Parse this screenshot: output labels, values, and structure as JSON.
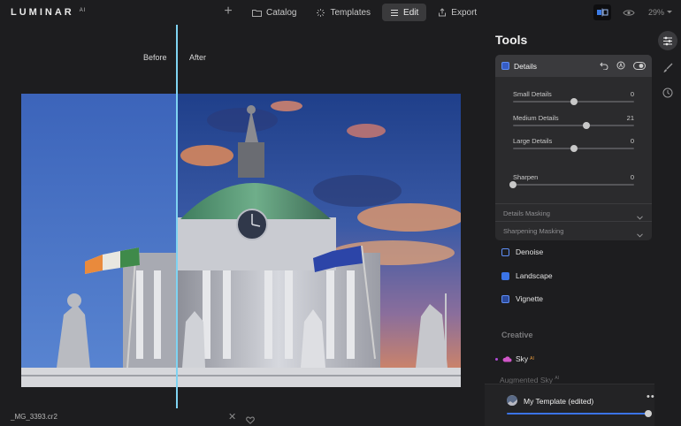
{
  "app": {
    "logo": "LUMINAR",
    "logo_suffix": "AI"
  },
  "nav": {
    "items": [
      {
        "label": "Catalog",
        "icon": "folder-icon"
      },
      {
        "label": "Templates",
        "icon": "templates-icon"
      },
      {
        "label": "Edit",
        "icon": "sliders-icon",
        "active": true
      },
      {
        "label": "Export",
        "icon": "export-icon"
      }
    ],
    "zoom": "29%"
  },
  "canvas": {
    "before_label": "Before",
    "after_label": "After",
    "filename": "_MG_3393.cr2"
  },
  "tools": {
    "title": "Tools",
    "details": {
      "title": "Details",
      "sliders": [
        {
          "label": "Small Details",
          "value": "0",
          "position": 0.5
        },
        {
          "label": "Medium Details",
          "value": "21",
          "position": 0.605
        },
        {
          "label": "Large Details",
          "value": "0",
          "position": 0.5
        },
        {
          "label": "Sharpen",
          "value": "0",
          "position": 0.0
        }
      ],
      "sections": [
        "Details Masking",
        "Sharpening Masking"
      ]
    },
    "items": [
      {
        "label": "Denoise",
        "icon": "denoise-icon",
        "color": "#5e8ef5"
      },
      {
        "label": "Landscape",
        "icon": "landscape-icon",
        "color": "#5e8ef5"
      },
      {
        "label": "Vignette",
        "icon": "vignette-icon",
        "color": "#5e8ef5"
      }
    ],
    "creative_title": "Creative",
    "sky": {
      "label": "Sky",
      "badge": "AI"
    },
    "augmented": {
      "label": "Augmented Sky",
      "badge": "AI"
    }
  },
  "template": {
    "name": "My Template (edited)",
    "more": "•••",
    "amount": 0.98
  },
  "colors": {
    "accent": "#3b74e6",
    "divider": "#7fd3f2",
    "panel": "#2b2b2d"
  }
}
